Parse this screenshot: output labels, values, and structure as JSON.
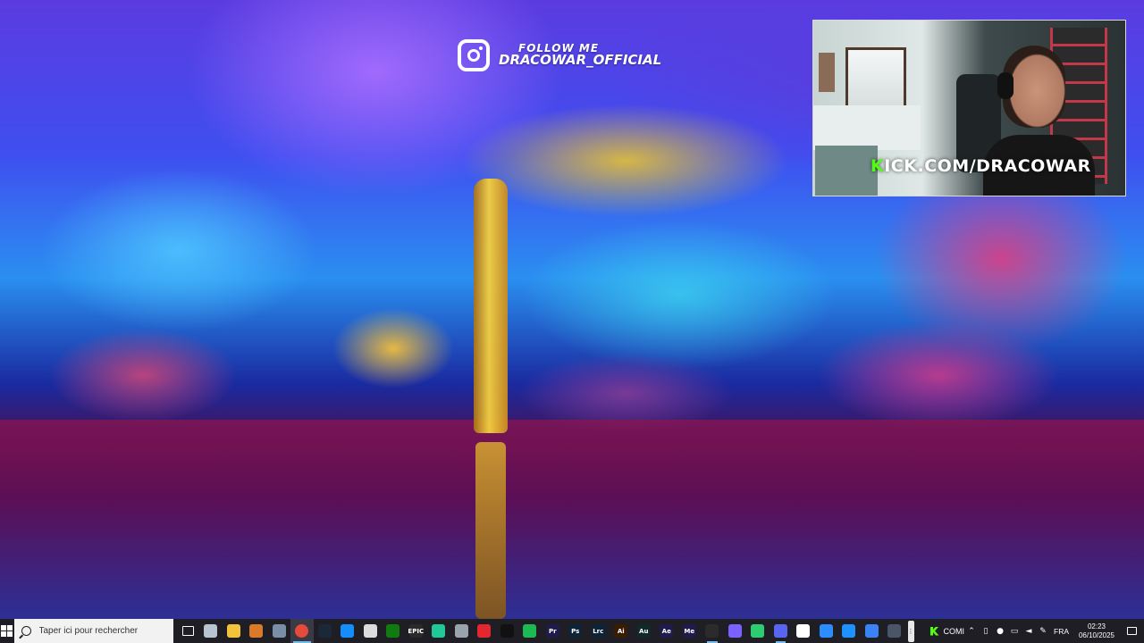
{
  "overlay": {
    "follow_line1": "FOLLOW ME",
    "follow_line2": "DRACOWAR_OFFICIAL",
    "webcam_k": "K",
    "webcam_label": "ICK.COM/DRACOWAR"
  },
  "taskbar": {
    "search_placeholder": "Taper ici pour rechercher",
    "apps": [
      {
        "name": "task-view",
        "text": "",
        "color": "#1e1e24"
      },
      {
        "name": "windows-explorer-old",
        "text": "",
        "color": "#b8c4d0"
      },
      {
        "name": "file-explorer",
        "text": "",
        "color": "#f3c33c"
      },
      {
        "name": "app-settings-alt",
        "text": "",
        "color": "#d97a2b"
      },
      {
        "name": "app-network",
        "text": "",
        "color": "#7a8ea8"
      },
      {
        "name": "chrome",
        "text": "",
        "color": "#e64a3b"
      },
      {
        "name": "steam",
        "text": "",
        "color": "#1b2838"
      },
      {
        "name": "battlenet",
        "text": "",
        "color": "#148eff"
      },
      {
        "name": "ubisoft",
        "text": "",
        "color": "#dcdcdc"
      },
      {
        "name": "xbox",
        "text": "",
        "color": "#107c10"
      },
      {
        "name": "epic-games",
        "text": "EPIC",
        "color": "#2a2a2a"
      },
      {
        "name": "app-green",
        "text": "",
        "color": "#20c997"
      },
      {
        "name": "app-gray",
        "text": "",
        "color": "#9aa3ad"
      },
      {
        "name": "app-red",
        "text": "",
        "color": "#e3262f"
      },
      {
        "name": "capcut",
        "text": "",
        "color": "#111111"
      },
      {
        "name": "spotify",
        "text": "",
        "color": "#1db954"
      },
      {
        "name": "premiere",
        "text": "Pr",
        "color": "#1f1b4d"
      },
      {
        "name": "photoshop",
        "text": "Ps",
        "color": "#0d2438"
      },
      {
        "name": "lightroom",
        "text": "Lrc",
        "color": "#0d2438"
      },
      {
        "name": "illustrator",
        "text": "Ai",
        "color": "#3a1d00"
      },
      {
        "name": "audition",
        "text": "Au",
        "color": "#0f2a2a"
      },
      {
        "name": "after-effects",
        "text": "Ae",
        "color": "#1f1b4d"
      },
      {
        "name": "media-encoder",
        "text": "Me",
        "color": "#1f1b4d"
      },
      {
        "name": "obs",
        "text": "",
        "color": "#2b2b2b"
      },
      {
        "name": "app-purple",
        "text": "",
        "color": "#7b61ff"
      },
      {
        "name": "app-green2",
        "text": "",
        "color": "#2ecc71"
      },
      {
        "name": "discord",
        "text": "",
        "color": "#5865f2"
      },
      {
        "name": "app-arrow",
        "text": "",
        "color": "#ffffff"
      },
      {
        "name": "app-blue",
        "text": "",
        "color": "#2d8cff"
      },
      {
        "name": "app-blue2",
        "text": "",
        "color": "#1e90ff"
      },
      {
        "name": "app-blue3",
        "text": "",
        "color": "#3b82f6"
      },
      {
        "name": "app-arc",
        "text": "",
        "color": "#4a5568"
      }
    ],
    "kick_tray_label": "COMI",
    "language": "FRA",
    "time": "02:23",
    "date": "06/10/2025",
    "notification_count": "1"
  }
}
